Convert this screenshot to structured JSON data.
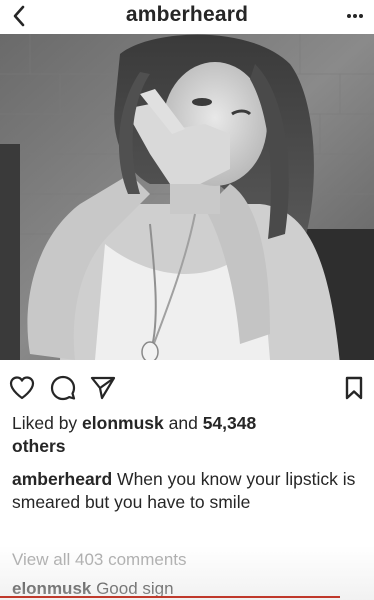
{
  "header": {
    "username": "amberheard",
    "back_icon": "chevron-left-icon",
    "more_icon": "more-dots-icon"
  },
  "post": {
    "photo_icon": "photo",
    "actions": {
      "like_icon": "heart-icon",
      "comment_icon": "comment-icon",
      "share_icon": "send-icon",
      "save_icon": "bookmark-icon"
    },
    "likes": {
      "prefix": "Liked by ",
      "user": "elonmusk",
      "middle": " and ",
      "count": "54,348",
      "suffix": "others"
    },
    "caption": {
      "user": "amberheard",
      "text": " When you know your lipstick is smeared but you have to smile"
    },
    "view_all": "View all 403 comments",
    "comment": {
      "user": "elonmusk",
      "text": " Good sign"
    }
  },
  "colors": {
    "text": "#262626",
    "muted": "#a8a8a8",
    "background": "#ffffff",
    "underline": "#c0392b"
  }
}
